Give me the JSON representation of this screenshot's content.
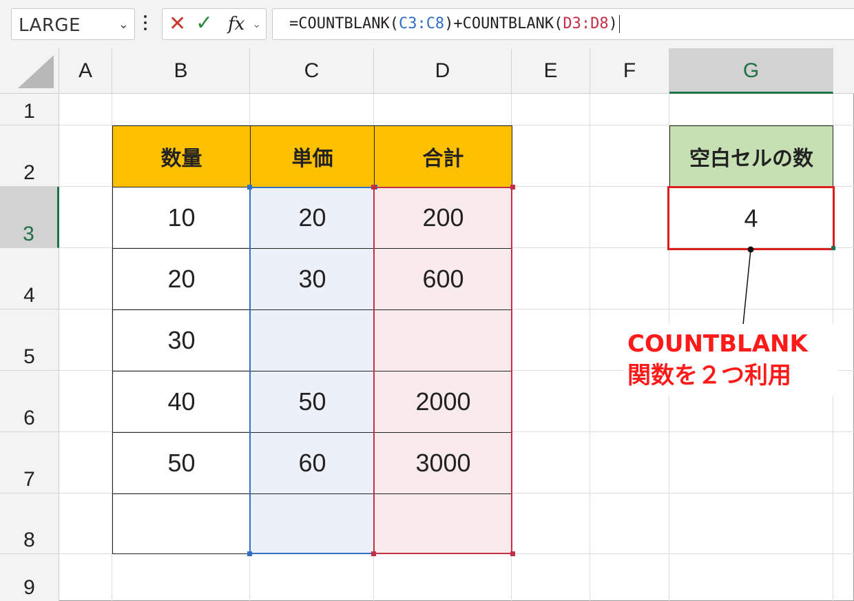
{
  "name_box": {
    "value": "LARGE"
  },
  "formula_bar": {
    "parts": [
      "=COUNTBLANK(",
      "C3:C8",
      ")+COUNTBLANK(",
      "D3:D8",
      ")"
    ]
  },
  "columns": [
    "A",
    "B",
    "C",
    "D",
    "E",
    "F",
    "G"
  ],
  "rows": [
    "1",
    "2",
    "3",
    "4",
    "5",
    "6",
    "7",
    "8",
    "9"
  ],
  "table": {
    "headers": [
      "数量",
      "単価",
      "合計"
    ],
    "rows": [
      [
        "10",
        "20",
        "200"
      ],
      [
        "20",
        "30",
        "600"
      ],
      [
        "30",
        "",
        ""
      ],
      [
        "40",
        "50",
        "2000"
      ],
      [
        "50",
        "60",
        "3000"
      ],
      [
        "",
        "",
        ""
      ]
    ]
  },
  "result": {
    "label": "空白セルの数",
    "value": "4"
  },
  "callout": {
    "line1": "COUNTBLANK",
    "line2": "関数を２つ利用"
  },
  "colors": {
    "header": "#ffc000",
    "result_header": "#c6e0b4",
    "ref_c": "#2f6fc4",
    "ref_d": "#c42f45",
    "callout": "#ff1a1a"
  }
}
